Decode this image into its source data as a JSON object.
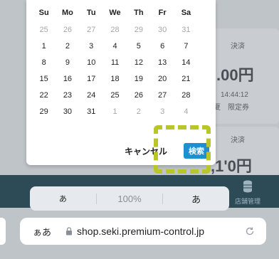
{
  "calendar": {
    "weekdays": [
      "Su",
      "Mo",
      "Tu",
      "We",
      "Th",
      "Fr",
      "Sa"
    ],
    "weeks": [
      [
        "25",
        "26",
        "27",
        "28",
        "29",
        "30",
        "31"
      ],
      [
        "1",
        "2",
        "3",
        "4",
        "5",
        "6",
        "7"
      ],
      [
        "8",
        "9",
        "10",
        "11",
        "12",
        "13",
        "14"
      ],
      [
        "15",
        "16",
        "17",
        "18",
        "19",
        "20",
        "21"
      ],
      [
        "22",
        "23",
        "24",
        "25",
        "26",
        "27",
        "28"
      ],
      [
        "29",
        "30",
        "31",
        "1",
        "2",
        "3",
        "4"
      ]
    ],
    "muted_rows": {
      "0": [
        0,
        1,
        2,
        3,
        4,
        5,
        6
      ],
      "5": [
        3,
        4,
        5,
        6
      ]
    },
    "cancel_label": "キャンセル",
    "search_label": "検索"
  },
  "background": {
    "card1_label": "決済",
    "card1_amount": ".00円",
    "card1_time": "14:44:12",
    "card1_note": "夏　限定券",
    "card2_label": "決済",
    "card2_amount": ",1'0円",
    "footer_label": "店舗管理"
  },
  "browser": {
    "zoom_small": "あ",
    "zoom_level": "100%",
    "zoom_large": "あ",
    "aa_label": "ぁあ",
    "url": "shop.seki.premium-control.jp"
  },
  "colors": {
    "accent": "#1e8fd0",
    "focus_marker": "#b9c62a",
    "footer_bg": "#2d4a57"
  }
}
